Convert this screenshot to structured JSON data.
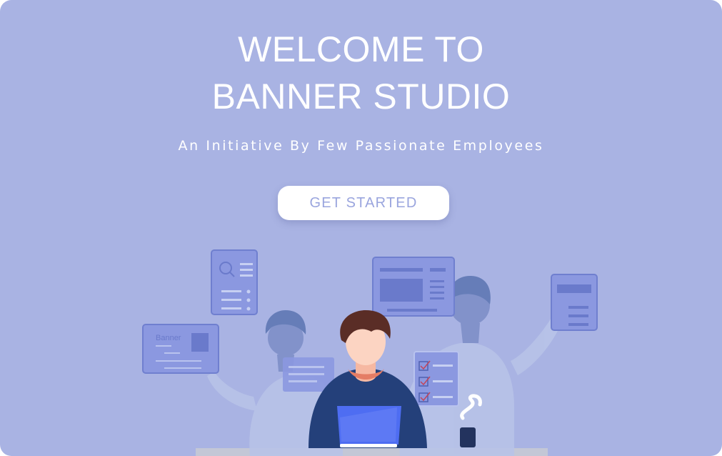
{
  "hero": {
    "title_line1": "WELCOME TO",
    "title_line2": "BANNER STUDIO",
    "subtitle": "An Initiative By Few Passionate Employees",
    "cta_label": "GET STARTED"
  },
  "illustration": {
    "card_label": "Banner"
  },
  "colors": {
    "background": "#a9b3e3",
    "button_text": "#9aa5de",
    "card": "#8b98e0",
    "person_shirt": "#24407a",
    "laptop": "#4e6df2"
  }
}
